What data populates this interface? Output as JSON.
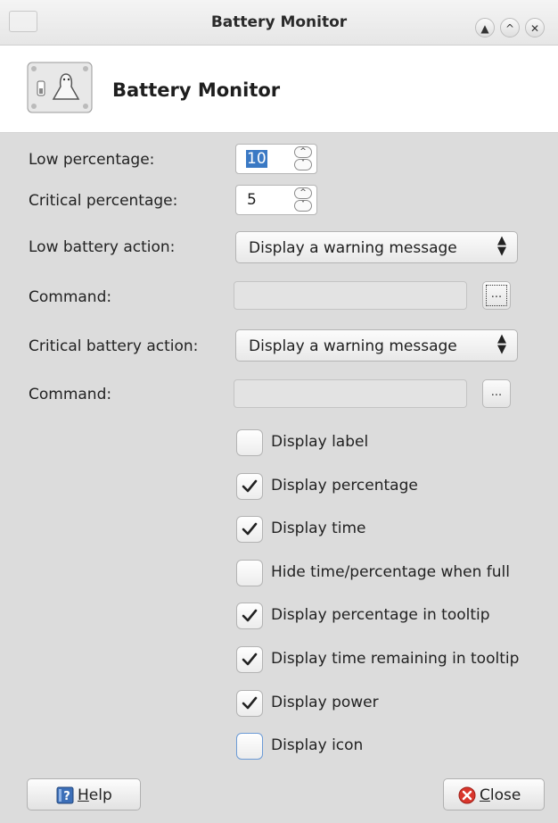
{
  "window": {
    "title": "Battery Monitor",
    "buttons": [
      "minimize",
      "maximize",
      "close"
    ]
  },
  "header": {
    "title": "Battery Monitor"
  },
  "form": {
    "low_percentage": {
      "label": "Low percentage:",
      "value": "10",
      "selected": true
    },
    "critical_percentage": {
      "label": "Critical percentage:",
      "value": "5"
    },
    "low_action": {
      "label": "Low battery action:",
      "value": "Display a warning message"
    },
    "low_command": {
      "label": "Command:",
      "value": "",
      "browse_label": "..."
    },
    "critical_action": {
      "label": "Critical battery action:",
      "value": "Display a warning message"
    },
    "critical_command": {
      "label": "Command:",
      "value": "",
      "browse_label": "..."
    }
  },
  "options": [
    {
      "label": "Display label",
      "checked": false
    },
    {
      "label": "Display percentage",
      "checked": true
    },
    {
      "label": "Display time",
      "checked": true
    },
    {
      "label": "Hide time/percentage when full",
      "checked": false
    },
    {
      "label": "Display percentage in tooltip",
      "checked": true
    },
    {
      "label": "Display time remaining in tooltip",
      "checked": true
    },
    {
      "label": "Display power",
      "checked": true
    },
    {
      "label": "Display icon",
      "checked": false,
      "focused": true
    }
  ],
  "footer": {
    "help": {
      "accel": "H",
      "rest": "elp"
    },
    "close": {
      "accel": "C",
      "rest": "lose"
    }
  },
  "colors": {
    "selection": "#3a79c4",
    "focus_ring": "#6c9bd6",
    "close_icon": "#d9362c",
    "help_icon": "#3c6fb8"
  }
}
